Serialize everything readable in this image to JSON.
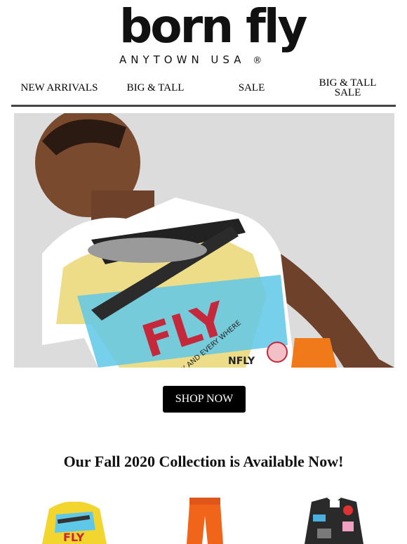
{
  "brand": {
    "wordmark": "born fly",
    "tagline": "ANYTOWN USA",
    "registered_mark": "®"
  },
  "nav": {
    "items": [
      {
        "label": "NEW ARRIVALS"
      },
      {
        "label": "BIG & TALL"
      },
      {
        "label": "SALE"
      },
      {
        "label": "BIG & TALL\nSALE"
      }
    ]
  },
  "hero": {
    "shirt_print_text": [
      "FLY",
      "FLY ANY AND EVERY WHERE",
      "NFLY"
    ]
  },
  "cta": {
    "label": "SHOP NOW"
  },
  "collection": {
    "headline": "Our Fall 2020 Collection is Available Now!"
  },
  "products": {
    "items": [
      {
        "name": "printed-sweatshirt",
        "print_text": "FLY"
      },
      {
        "name": "orange-track-pants"
      },
      {
        "name": "patched-denim-jacket"
      }
    ]
  },
  "colors": {
    "nav_rule": "#444444",
    "cta_bg": "#000000",
    "cta_text": "#ffffff",
    "background": "#ffffff"
  }
}
